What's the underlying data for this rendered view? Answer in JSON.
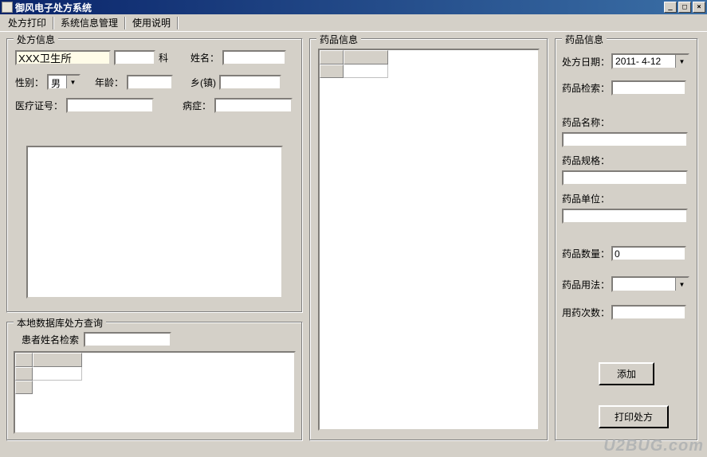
{
  "window": {
    "title": "御风电子处方系统"
  },
  "menu": {
    "items": [
      "处方打印",
      "系统信息管理",
      "使用说明"
    ]
  },
  "rx_info": {
    "title": "处方信息",
    "clinic": "XXX卫生所",
    "dept_label": "科",
    "name_label": "姓名：",
    "gender_label": "性别：",
    "gender_value": "男",
    "age_label": "年龄：",
    "town_label": "乡(镇)",
    "med_id_label": "医疗证号：",
    "symptom_label": "病症："
  },
  "local_query": {
    "title": "本地数据库处方查询",
    "search_label": "患者姓名检索"
  },
  "drug_list": {
    "title": "药品信息"
  },
  "drug_detail": {
    "title": "药品信息",
    "date_label": "处方日期：",
    "date_value": "2011- 4-12",
    "search_label": "药品检索：",
    "name_label": "药品名称：",
    "spec_label": "药品规格：",
    "unit_label": "药品单位：",
    "qty_label": "药品数量：",
    "qty_value": "0",
    "usage_label": "药品用法：",
    "freq_label": "用药次数：",
    "add_btn": "添加",
    "print_btn": "打印处方"
  },
  "watermark": "U2BUG.com"
}
